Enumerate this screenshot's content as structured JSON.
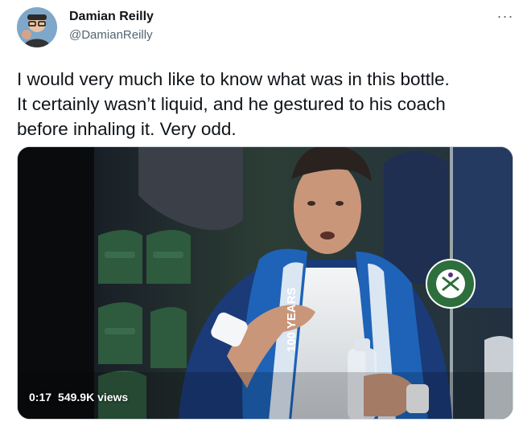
{
  "author": {
    "display_name": "Damian Reilly",
    "handle": "@DamianReilly",
    "avatar_icon": "profile-photo"
  },
  "menu": {
    "more_label": "···",
    "icon": "more-horizontal-icon"
  },
  "tweet": {
    "text_lines": [
      "I would very much like to know what was in this bottle.",
      "It certainly wasn’t liquid, and he gestured to his coach",
      "before inhaling it. Very odd."
    ]
  },
  "video": {
    "elapsed": "0:17",
    "views": "549.9K views",
    "badge_icon": "wimbledon-championships-logo",
    "badge_text": "THE CHAMPIONSHIPS WIMBLEDON",
    "towel_text": "100 YEARS"
  },
  "colors": {
    "text": "#0f1419",
    "secondary_text": "#536471",
    "border": "#cfd9de",
    "wimbledon_green": "#2d6f3c",
    "towel_blue": "#1e63b7"
  }
}
